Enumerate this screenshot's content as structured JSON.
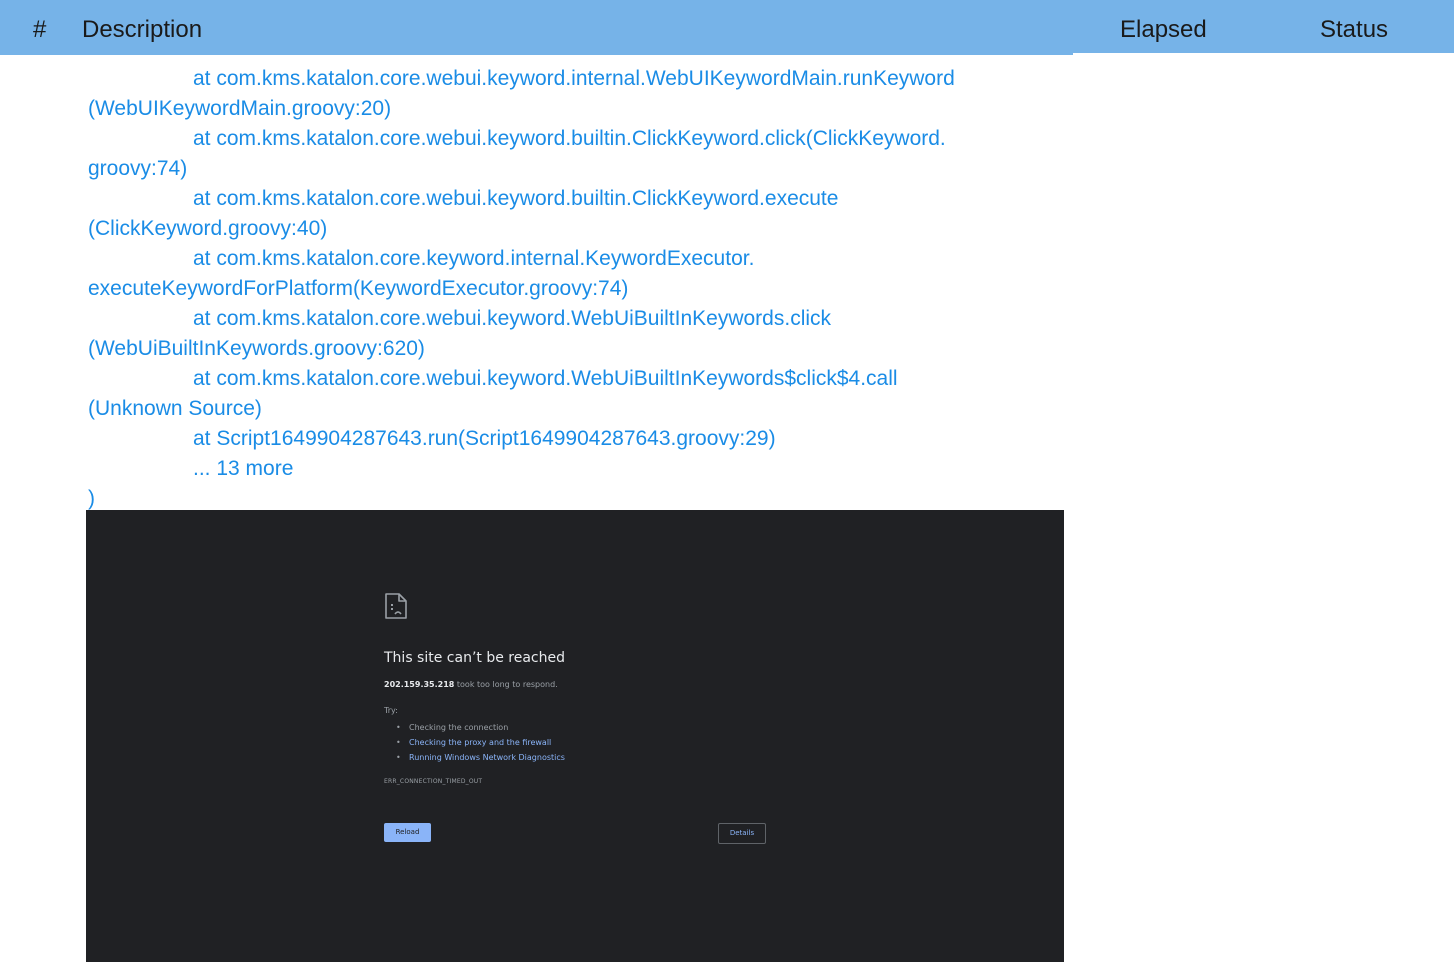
{
  "header": {
    "num": "#",
    "description": "Description",
    "elapsed": "Elapsed",
    "status": "Status"
  },
  "stack_lines": [
    "at com.kms.katalon.core.webui.keyword.internal.WebUIKeywordMain.runKeyword",
    "(WebUIKeywordMain.groovy:20)",
    "at com.kms.katalon.core.webui.keyword.builtin.ClickKeyword.click(ClickKeyword.",
    "groovy:74)",
    "at com.kms.katalon.core.webui.keyword.builtin.ClickKeyword.execute",
    "(ClickKeyword.groovy:40)",
    "at com.kms.katalon.core.keyword.internal.KeywordExecutor.",
    "executeKeywordForPlatform(KeywordExecutor.groovy:74)",
    "at com.kms.katalon.core.webui.keyword.WebUiBuiltInKeywords.click",
    "(WebUiBuiltInKeywords.groovy:620)",
    "at com.kms.katalon.core.webui.keyword.WebUiBuiltInKeywords$click$4.call",
    "(Unknown Source)",
    "at Script1649904287643.run(Script1649904287643.groovy:29)",
    "... 13 more",
    ")"
  ],
  "error_page": {
    "icon": "sad-page-icon",
    "title": "This site can’t be reached",
    "host": "202.159.35.218",
    "message_suffix": " took too long to respond.",
    "try_label": "Try:",
    "suggestions": [
      "Checking the connection",
      "Checking the proxy and the firewall",
      "Running Windows Network Diagnostics"
    ],
    "error_code": "ERR_CONNECTION_TIMED_OUT",
    "reload_label": "Reload",
    "details_label": "Details"
  },
  "colors": {
    "header_bg": "#76b3e8",
    "stack_text": "#1a8ce6",
    "screenshot_bg": "#202124",
    "link": "#8ab4f8"
  }
}
